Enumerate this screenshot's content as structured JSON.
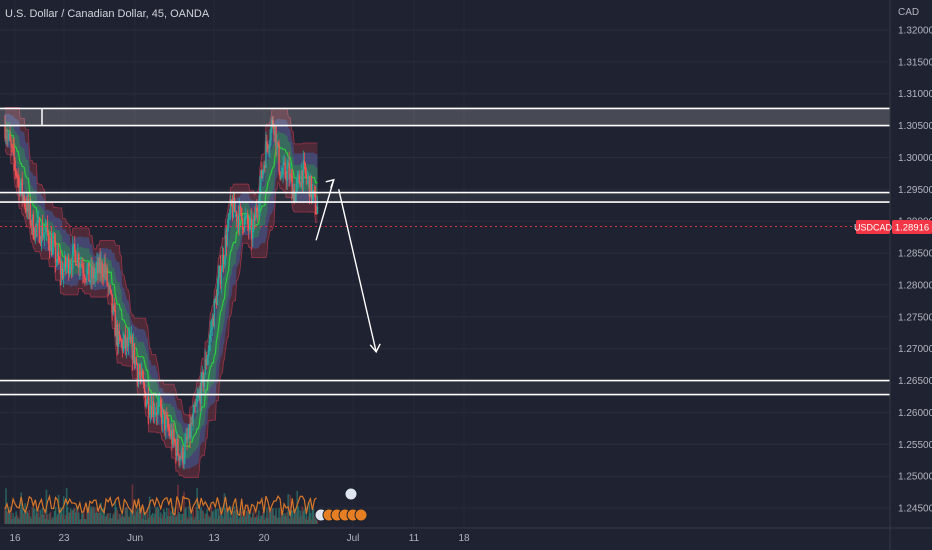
{
  "header": {
    "title": "U.S. Dollar / Canadian Dollar, 45, OANDA",
    "currency": "CAD"
  },
  "price_badge": {
    "symbol": "USDCAD",
    "price": "1.28916"
  },
  "colors": {
    "background": "#1f2230",
    "up": "#26a69a",
    "down": "#ef5350",
    "level_line": "#ffffff",
    "badge": "#f23645",
    "outer_band": "#b0384c",
    "mid_band": "#3c6bb4",
    "inner_band": "#26a045",
    "volume": "#d8762a"
  },
  "chart_data": {
    "type": "candlestick",
    "title": "U.S. Dollar / Canadian Dollar, 45, OANDA",
    "ylabel": "CAD",
    "ylim": [
      1.241,
      1.325
    ],
    "y_ticks": [
      "1.32000",
      "1.31500",
      "1.31000",
      "1.30500",
      "1.30000",
      "1.29500",
      "1.29000",
      "1.28500",
      "1.28000",
      "1.27500",
      "1.27000",
      "1.26500",
      "1.26000",
      "1.25500",
      "1.25000",
      "1.24500"
    ],
    "x_ticks": [
      "16",
      "23",
      "Jun",
      "13",
      "20",
      "Jul",
      "11",
      "18"
    ],
    "last_price": 1.28916,
    "close_path": [
      [
        0,
        1.305
      ],
      [
        2,
        1.296
      ],
      [
        4,
        1.289
      ],
      [
        6,
        1.288
      ],
      [
        8,
        1.282
      ],
      [
        10,
        1.285
      ],
      [
        12,
        1.281
      ],
      [
        14,
        1.283
      ],
      [
        16,
        1.271
      ],
      [
        18,
        1.27
      ],
      [
        20,
        1.262
      ],
      [
        22,
        1.26
      ],
      [
        24,
        1.255
      ],
      [
        25,
        1.253
      ],
      [
        26,
        1.256
      ],
      [
        28,
        1.265
      ],
      [
        30,
        1.279
      ],
      [
        32,
        1.292
      ],
      [
        34,
        1.29
      ],
      [
        35,
        1.288
      ],
      [
        37,
        1.302
      ],
      [
        38,
        1.306
      ],
      [
        39,
        1.297
      ],
      [
        40,
        1.298
      ],
      [
        41,
        1.294
      ],
      [
        42,
        1.298
      ],
      [
        43,
        1.296
      ],
      [
        44,
        1.292
      ]
    ],
    "levels": [
      {
        "zone": [
          1.305,
          1.3077
        ]
      },
      {
        "zone": [
          1.293,
          1.2945
        ]
      },
      {
        "zone": [
          1.2628,
          1.265
        ]
      }
    ],
    "projection": [
      [
        44,
        1.287
      ],
      [
        46.5,
        1.2965
      ],
      [
        47.2,
        1.295
      ],
      [
        52.5,
        1.2695
      ]
    ],
    "annotations": []
  }
}
